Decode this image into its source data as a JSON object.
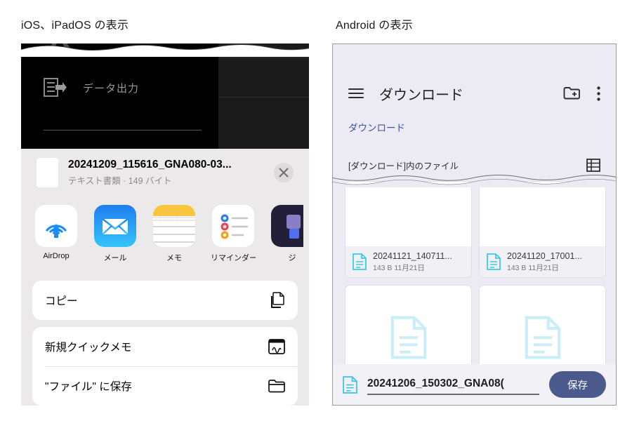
{
  "captions": {
    "ios": "iOS、iPadOS の表示",
    "android": "Android の表示"
  },
  "ios": {
    "dark_overlay": {
      "export_label": "データ出力",
      "export_icon": "document-export-icon"
    },
    "file_header": {
      "filename": "20241209_115616_GNA080-03...",
      "subtitle": "テキスト書類 · 149 バイト",
      "close_icon": "close-icon",
      "thumbnail_icon": "document-thumbnail"
    },
    "apps": [
      {
        "name": "AirDrop",
        "icon": "airdrop-icon"
      },
      {
        "name": "メール",
        "icon": "mail-icon"
      },
      {
        "name": "メモ",
        "icon": "notes-icon"
      },
      {
        "name": "リマインダー",
        "icon": "reminders-icon"
      },
      {
        "name": "ジ",
        "icon": "partial-app-icon"
      }
    ],
    "actions_group_1": [
      {
        "label": "コピー",
        "icon": "copy-icon"
      }
    ],
    "actions_group_2": [
      {
        "label": "新規クイックメモ",
        "icon": "quick-note-icon"
      },
      {
        "label": "\"ファイル\" に保存",
        "icon": "folder-icon"
      }
    ]
  },
  "android": {
    "appbar": {
      "menu_icon": "hamburger-menu-icon",
      "title": "ダウンロード",
      "new_folder_icon": "new-folder-icon",
      "overflow_icon": "overflow-menu-icon"
    },
    "breadcrumb": "ダウンロード",
    "subbar": {
      "label": "[ダウンロード]内のファイル",
      "view_toggle_icon": "grid-view-toggle-icon"
    },
    "files": [
      {
        "name": "20241121_140711...",
        "meta": "143 B 11月21日",
        "icon": "text-file-icon"
      },
      {
        "name": "20241120_17001...",
        "meta": "143 B 11月21日",
        "icon": "text-file-icon"
      },
      {
        "name": "",
        "meta": "",
        "icon": "text-file-icon"
      },
      {
        "name": "",
        "meta": "",
        "icon": "text-file-icon"
      }
    ],
    "bottom_bar": {
      "file_icon": "text-file-icon",
      "filename_value": "20241206_150302_GNA08(",
      "save_label": "保存"
    }
  },
  "colors": {
    "android_accent": "#3f51a8",
    "save_button": "#4a5a8c",
    "file_icon_cyan": "#3fc8ec",
    "panel_bg": "#eceaf2"
  }
}
